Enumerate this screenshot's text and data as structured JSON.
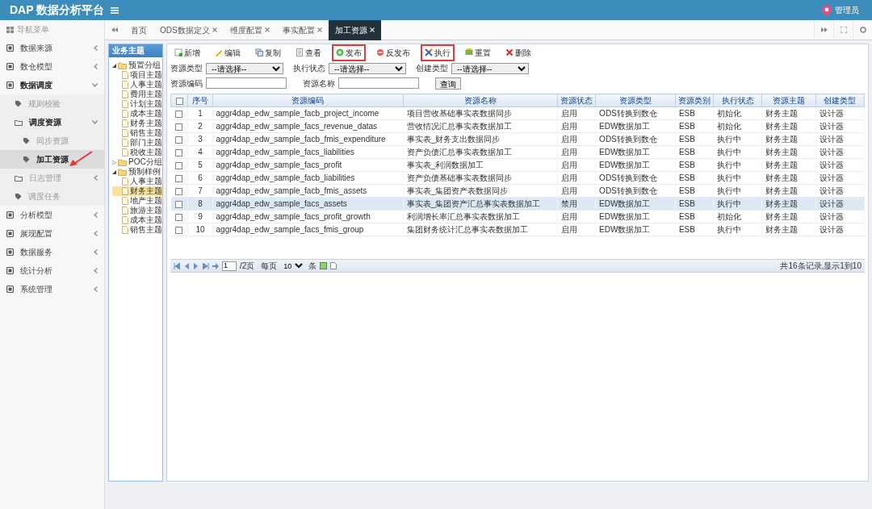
{
  "header": {
    "title": "DAP 数据分析平台",
    "user": "管理员"
  },
  "sidebar": {
    "title": "导航菜单",
    "items": [
      {
        "label": "数据来源",
        "expanded": false,
        "selected": false
      },
      {
        "label": "数仓模型",
        "expanded": false,
        "selected": false
      },
      {
        "label": "数据调度",
        "expanded": true,
        "selected": false,
        "children": [
          {
            "label": "规则校验",
            "selected": false
          },
          {
            "label": "调度资源",
            "expanded": true,
            "selected": false,
            "children": [
              {
                "label": "同步资源",
                "selected": false
              },
              {
                "label": "加工资源",
                "selected": true,
                "arrow": true
              }
            ]
          },
          {
            "label": "日志管理",
            "expanded": false,
            "selected": false
          },
          {
            "label": "调度任务",
            "selected": false
          }
        ]
      },
      {
        "label": "分析模型",
        "expanded": false,
        "selected": false
      },
      {
        "label": "展现配置",
        "expanded": false,
        "selected": false
      },
      {
        "label": "数据服务",
        "expanded": false,
        "selected": false
      },
      {
        "label": "统计分析",
        "expanded": false,
        "selected": false
      },
      {
        "label": "系统管理",
        "expanded": false,
        "selected": false
      }
    ]
  },
  "tabs": [
    {
      "label": "首页",
      "closable": false,
      "selected": false
    },
    {
      "label": "ODS数据定义",
      "closable": true,
      "selected": false
    },
    {
      "label": "维度配置",
      "closable": true,
      "selected": false
    },
    {
      "label": "事实配置",
      "closable": true,
      "selected": false
    },
    {
      "label": "加工资源",
      "closable": true,
      "selected": true
    }
  ],
  "tree": {
    "title": "业务主题",
    "items": [
      {
        "label": "预置分组",
        "expanded": true,
        "children": [
          {
            "label": "项目主题",
            "selected": false
          },
          {
            "label": "人事主题",
            "selected": false
          },
          {
            "label": "费用主题",
            "selected": false
          },
          {
            "label": "计划主题",
            "selected": false
          },
          {
            "label": "成本主题",
            "selected": false
          },
          {
            "label": "财务主题",
            "selected": false
          },
          {
            "label": "销售主题",
            "selected": false
          },
          {
            "label": "部门主题",
            "selected": false
          },
          {
            "label": "税收主题",
            "selected": false
          }
        ]
      },
      {
        "label": "POC分组",
        "expanded": false
      },
      {
        "label": "预制样例",
        "expanded": true,
        "children": [
          {
            "label": "人事主题",
            "selected": false
          },
          {
            "label": "财务主题",
            "selected": true
          },
          {
            "label": "地产主题",
            "selected": false
          },
          {
            "label": "旅游主题",
            "selected": false
          },
          {
            "label": "成本主题",
            "selected": false
          },
          {
            "label": "销售主题",
            "selected": false
          }
        ]
      }
    ]
  },
  "toolbar": [
    {
      "label": "新增",
      "highlighted": false
    },
    {
      "label": "编辑",
      "highlighted": false
    },
    {
      "label": "复制",
      "highlighted": false
    },
    {
      "label": "查看",
      "highlighted": false
    },
    {
      "label": "发布",
      "highlighted": true
    },
    {
      "label": "反发布",
      "highlighted": false
    },
    {
      "label": "执行",
      "highlighted": true
    },
    {
      "label": "重置",
      "highlighted": false
    },
    {
      "label": "删除",
      "highlighted": false
    }
  ],
  "filters": {
    "selects": [
      {
        "label": "资源类型",
        "value": "--请选择--"
      },
      {
        "label": "执行状态",
        "value": "--请选择--"
      },
      {
        "label": "创建类型",
        "value": "--请选择--"
      }
    ],
    "inputs": [
      {
        "label": "资源编码"
      },
      {
        "label": "资源名称"
      }
    ],
    "button": "查询"
  },
  "table": {
    "header_checked": false,
    "columns": [
      "序号",
      "资源编码",
      "资源名称",
      "资源状态",
      "资源类型",
      "资源类别",
      "执行状态",
      "资源主题",
      "创建类型"
    ],
    "rows": [
      {
        "checked": false,
        "selected": false,
        "cells": [
          "1",
          "aggr4dap_edw_sample_facb_project_income",
          "项目营收基础事实表数据同步",
          "启用",
          "ODS转换到数仓",
          "ESB",
          "初始化",
          "财务主题",
          "设计器"
        ]
      },
      {
        "checked": false,
        "selected": false,
        "cells": [
          "2",
          "aggr4dap_edw_sample_facs_revenue_datas",
          "营收情况汇总事实表数据加工",
          "启用",
          "EDW数据加工",
          "ESB",
          "初始化",
          "财务主题",
          "设计器"
        ]
      },
      {
        "checked": false,
        "selected": false,
        "cells": [
          "3",
          "aggr4dap_edw_sample_facb_fmis_expenditure",
          "事实表_财务支出数据同步",
          "启用",
          "ODS转换到数仓",
          "ESB",
          "执行中",
          "财务主题",
          "设计器"
        ]
      },
      {
        "checked": false,
        "selected": false,
        "cells": [
          "4",
          "aggr4dap_edw_sample_facs_liabilities",
          "资产负债汇总事实表数据加工",
          "启用",
          "EDW数据加工",
          "ESB",
          "执行中",
          "财务主题",
          "设计器"
        ]
      },
      {
        "checked": false,
        "selected": false,
        "cells": [
          "5",
          "aggr4dap_edw_sample_facs_profit",
          "事实表_利润数据加工",
          "启用",
          "EDW数据加工",
          "ESB",
          "执行中",
          "财务主题",
          "设计器"
        ]
      },
      {
        "checked": false,
        "selected": false,
        "cells": [
          "6",
          "aggr4dap_edw_sample_facb_liabilities",
          "资产负债基础事实表数据同步",
          "启用",
          "ODS转换到数仓",
          "ESB",
          "执行中",
          "财务主题",
          "设计器"
        ]
      },
      {
        "checked": false,
        "selected": false,
        "cells": [
          "7",
          "aggr4dap_edw_sample_facb_fmis_assets",
          "事实表_集团资产表数据同步",
          "启用",
          "ODS转换到数仓",
          "ESB",
          "执行中",
          "财务主题",
          "设计器"
        ]
      },
      {
        "checked": false,
        "selected": true,
        "cells": [
          "8",
          "aggr4dap_edw_sample_facs_assets",
          "事实表_集团资产汇总事实表数据加工",
          "禁用",
          "EDW数据加工",
          "ESB",
          "执行中",
          "财务主题",
          "设计器"
        ]
      },
      {
        "checked": false,
        "selected": false,
        "cells": [
          "9",
          "aggr4dap_edw_sample_facs_profit_growth",
          "利润增长率汇总事实表数据加工",
          "启用",
          "EDW数据加工",
          "ESB",
          "初始化",
          "财务主题",
          "设计器"
        ]
      },
      {
        "checked": false,
        "selected": false,
        "cells": [
          "10",
          "aggr4dap_edw_sample_facs_fmis_group",
          "集团财务统计汇总事实表数据加工",
          "启用",
          "EDW数据加工",
          "ESB",
          "执行中",
          "财务主题",
          "设计器"
        ]
      }
    ]
  },
  "pager": {
    "page": "1",
    "pages": "/2页",
    "per_page_label": "每页",
    "per_page": "10",
    "unit": "条",
    "summary": "共16条记录,显示1到10"
  }
}
